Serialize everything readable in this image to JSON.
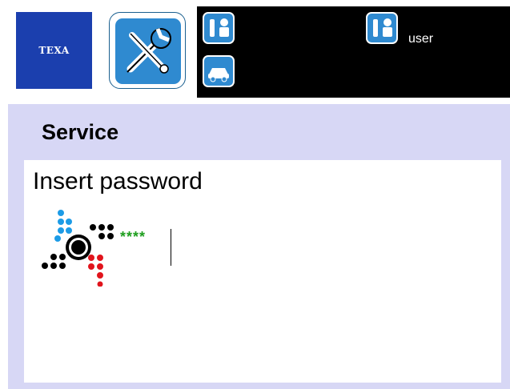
{
  "brand": {
    "logo_text": "TEXA"
  },
  "header": {
    "user_label": "user",
    "icons": [
      "service-tools-icon",
      "technician-icon",
      "vehicle-icon",
      "technician-icon"
    ]
  },
  "colors": {
    "topbar": "#000000",
    "body_background": "#d7d7f5",
    "accent_blue": "#2f8ad0",
    "brand_blue": "#1b3fae",
    "mask_green": "#1e9e1e"
  },
  "page": {
    "title": "Service"
  },
  "password": {
    "prompt": "Insert password",
    "masked_value": "****"
  }
}
